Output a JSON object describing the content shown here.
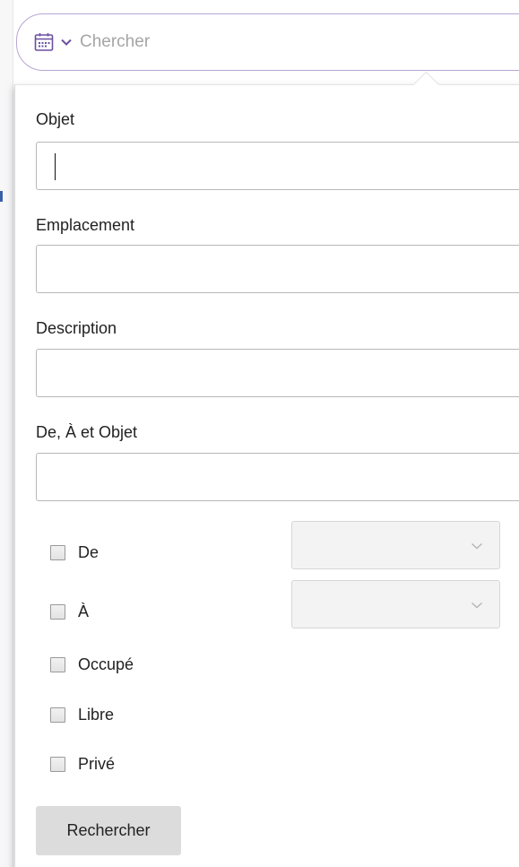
{
  "search": {
    "placeholder": "Chercher",
    "scope_icon": "calendar-icon",
    "scope_dropdown_icon": "chevron-down-icon"
  },
  "form": {
    "fields": [
      {
        "label": "Objet",
        "value": ""
      },
      {
        "label": "Emplacement",
        "value": ""
      },
      {
        "label": "Description",
        "value": ""
      },
      {
        "label": "De, À et Objet",
        "value": ""
      }
    ],
    "date_filters": [
      {
        "label": "De",
        "checked": false,
        "selected": ""
      },
      {
        "label": "À",
        "checked": false,
        "selected": ""
      }
    ],
    "status_filters": [
      {
        "label": "Occupé",
        "checked": false
      },
      {
        "label": "Libre",
        "checked": false
      },
      {
        "label": "Privé",
        "checked": false
      }
    ],
    "submit_label": "Rechercher"
  },
  "colors": {
    "searchbar_border": "#b9a6d4",
    "icon_purple": "#6b4fa0",
    "button_bg": "#dcdcdc"
  }
}
